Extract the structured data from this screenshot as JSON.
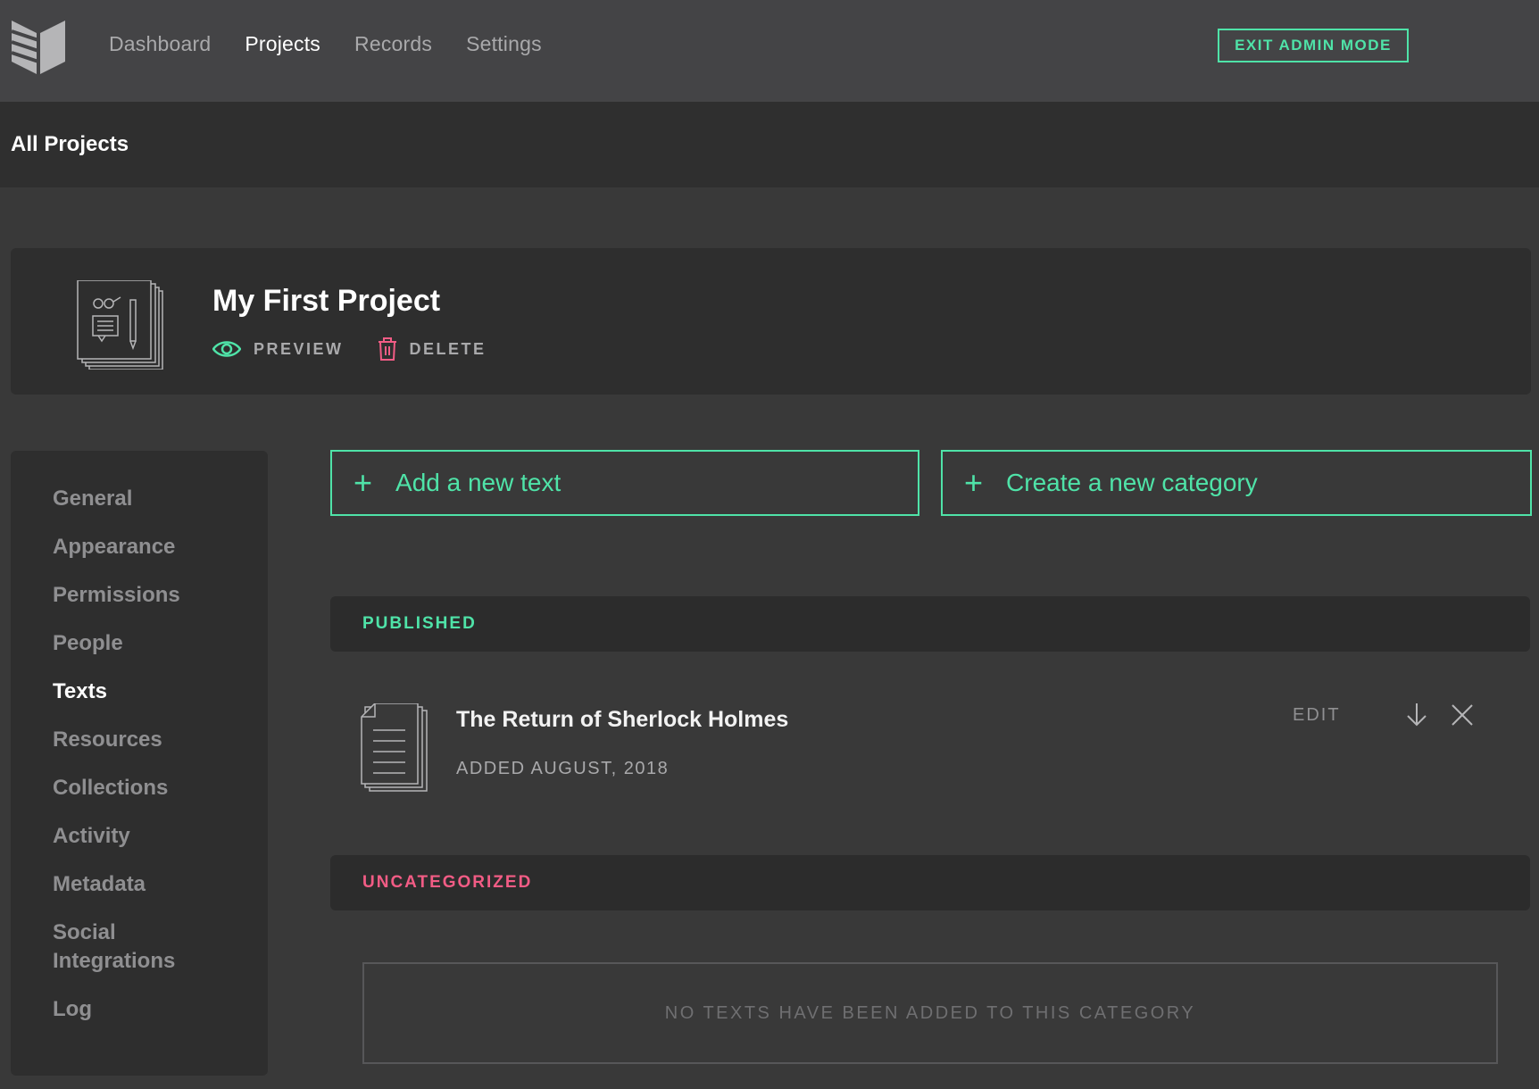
{
  "nav": {
    "items": [
      {
        "label": "Dashboard"
      },
      {
        "label": "Projects",
        "active": true
      },
      {
        "label": "Records"
      },
      {
        "label": "Settings"
      }
    ],
    "exit_admin_label": "EXIT ADMIN MODE"
  },
  "subheader": {
    "title": "All Projects"
  },
  "project": {
    "title": "My First Project",
    "preview_label": "PREVIEW",
    "delete_label": "DELETE"
  },
  "sidebar": {
    "items": [
      {
        "label": "General"
      },
      {
        "label": "Appearance"
      },
      {
        "label": "Permissions"
      },
      {
        "label": "People"
      },
      {
        "label": "Texts",
        "active": true
      },
      {
        "label": "Resources"
      },
      {
        "label": "Collections"
      },
      {
        "label": "Activity"
      },
      {
        "label": "Metadata"
      },
      {
        "label": "Social Integrations"
      },
      {
        "label": "Log"
      }
    ]
  },
  "actions": {
    "add_text": "Add a new text",
    "create_category": "Create a new category"
  },
  "categories": {
    "published": {
      "label": "PUBLISHED",
      "texts": [
        {
          "title": "The Return of Sherlock Holmes",
          "meta": "ADDED AUGUST, 2018",
          "edit_label": "EDIT"
        }
      ]
    },
    "uncategorized": {
      "label": "UNCATEGORIZED",
      "empty_message": "NO TEXTS HAVE BEEN ADDED TO THIS CATEGORY"
    }
  },
  "colors": {
    "accent": "#4fe3a8",
    "danger": "#f25c85",
    "topbar": "#444446",
    "background": "#393939",
    "panel": "#2e2e2e"
  },
  "icons": [
    "logo-icon",
    "eye-icon",
    "trash-icon",
    "plus-icon",
    "document-icon",
    "arrow-down-icon",
    "close-icon",
    "project-thumbnail-icon"
  ]
}
